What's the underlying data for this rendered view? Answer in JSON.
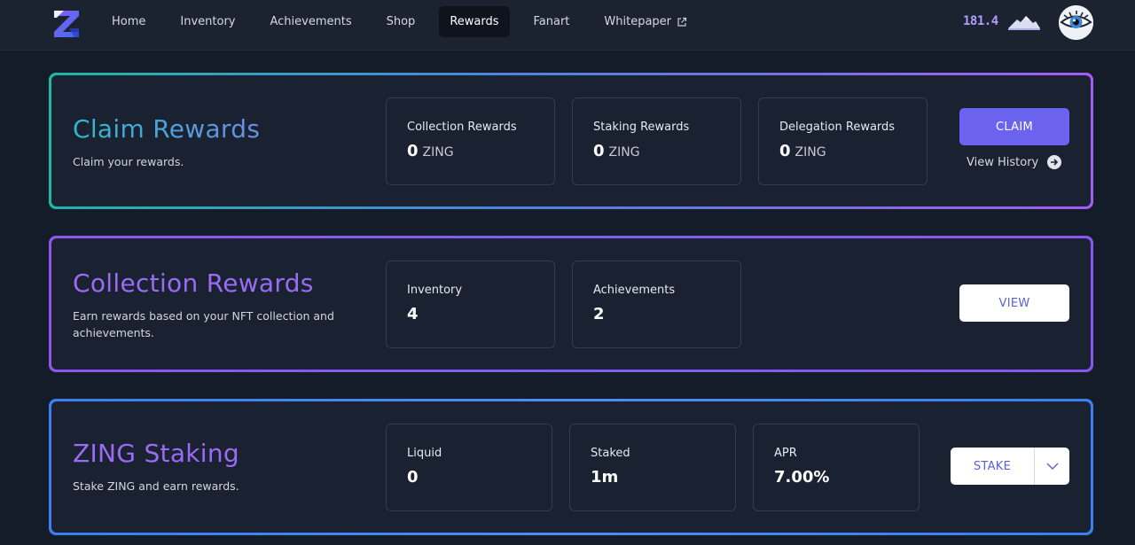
{
  "nav": {
    "items": [
      {
        "label": "Home",
        "active": false
      },
      {
        "label": "Inventory",
        "active": false
      },
      {
        "label": "Achievements",
        "active": false
      },
      {
        "label": "Shop",
        "active": false
      },
      {
        "label": "Rewards",
        "active": true
      },
      {
        "label": "Fanart",
        "active": false
      },
      {
        "label": "Whitepaper",
        "active": false,
        "external": true
      }
    ],
    "balance": "181.4",
    "balance_icon": "mountain-icon",
    "avatar_icon": "eye-avatar"
  },
  "claim": {
    "title": "Claim Rewards",
    "subtitle": "Claim your rewards.",
    "stats": [
      {
        "label": "Collection Rewards",
        "value": "0",
        "unit": "ZING"
      },
      {
        "label": "Staking Rewards",
        "value": "0",
        "unit": "ZING"
      },
      {
        "label": "Delegation Rewards",
        "value": "0",
        "unit": "ZING"
      }
    ],
    "button_label": "CLAIM",
    "history_label": "View History"
  },
  "collection": {
    "title": "Collection Rewards",
    "subtitle": "Earn rewards based on your NFT collection and achievements.",
    "stats": [
      {
        "label": "Inventory",
        "value": "4"
      },
      {
        "label": "Achievements",
        "value": "2"
      }
    ],
    "button_label": "VIEW"
  },
  "staking": {
    "title": "ZING Staking",
    "subtitle": "Stake ZING and earn rewards.",
    "stats": [
      {
        "label": "Liquid",
        "value": "0"
      },
      {
        "label": "Staked",
        "value": "1m"
      },
      {
        "label": "APR",
        "value": "7.00%"
      }
    ],
    "button_label": "STAKE"
  },
  "colors": {
    "accent": "#6b63ef",
    "purple_title": "#9a6cf5",
    "background": "#141b29",
    "card": "#1a2130"
  }
}
